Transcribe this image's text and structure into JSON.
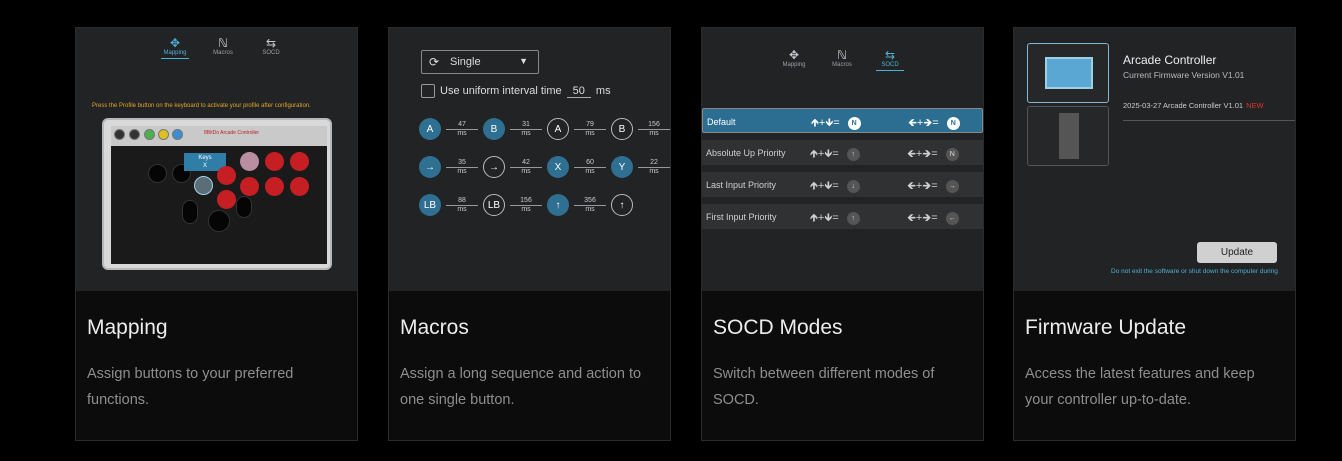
{
  "cards": [
    {
      "title": "Mapping",
      "desc": "Assign buttons to your preferred functions."
    },
    {
      "title": "Macros",
      "desc": "Assign a long sequence and action to one single button."
    },
    {
      "title": "SOCD Modes",
      "desc": "Switch between different modes of SOCD."
    },
    {
      "title": "Firmware Update",
      "desc": "Access the latest features and keep your controller up-to-date."
    }
  ],
  "tabs": {
    "mapping": "Mapping",
    "macros": "Macros",
    "socd": "SOCD"
  },
  "mapping": {
    "hint": "Press the Profile button on the keyboard to activate your profile after configuration.",
    "brand": "8BitDo Arcade Controller",
    "keys_label": "Keys",
    "keys_value": "X"
  },
  "macros": {
    "mode": "Single",
    "uniform_label": "Use uniform interval time",
    "uniform_value": "50",
    "unit": "ms",
    "rows": [
      [
        {
          "b": "A",
          "t": "fill",
          "ms": "47"
        },
        {
          "b": "B",
          "t": "fill",
          "ms": "31"
        },
        {
          "b": "A",
          "t": "ring",
          "ms": "79"
        },
        {
          "b": "B",
          "t": "ring",
          "ms": "156"
        }
      ],
      [
        {
          "b": "→",
          "t": "fill",
          "ms": "35"
        },
        {
          "b": "→",
          "t": "ring",
          "ms": "42"
        },
        {
          "b": "X",
          "t": "fill",
          "ms": "60"
        },
        {
          "b": "Y",
          "t": "fill",
          "ms": "22"
        }
      ],
      [
        {
          "b": "LB",
          "t": "fill",
          "ms": "88"
        },
        {
          "b": "LB",
          "t": "ring",
          "ms": "156"
        },
        {
          "b": "↑",
          "t": "fill",
          "ms": "356"
        },
        {
          "b": "↑",
          "t": "ring",
          "ms": ""
        }
      ]
    ]
  },
  "socd": {
    "rows": [
      {
        "name": "Default",
        "left": "N",
        "right": "N"
      },
      {
        "name": "Absolute Up Priority",
        "left": "↑",
        "right": "N"
      },
      {
        "name": "Last Input Priority",
        "left": "↓",
        "right": "→"
      },
      {
        "name": "First Input Priority",
        "left": "↑",
        "right": "←"
      }
    ],
    "vertical": "🡹+🡻=",
    "horizontal": "🡸+🡺="
  },
  "firmware": {
    "device": "Arcade Controller",
    "version": "Current Firmware Version V1.01",
    "log": "2025-03-27 Arcade Controller V1.01",
    "new_badge": "NEW",
    "update_label": "Update",
    "warning": "Do not exit the software or shut down the computer during"
  }
}
